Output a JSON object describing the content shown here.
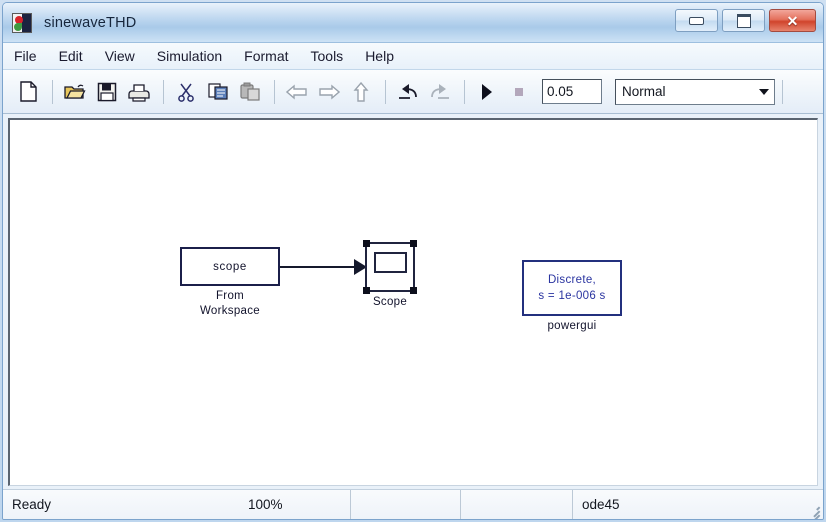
{
  "window": {
    "title": "sinewaveTHD",
    "app_icon": "simulink-icon",
    "controls": {
      "minimize": "minimize-icon",
      "maximize": "maximize-icon",
      "close": "✕"
    }
  },
  "menubar": {
    "items": [
      {
        "label": "File"
      },
      {
        "label": "Edit"
      },
      {
        "label": "View"
      },
      {
        "label": "Simulation"
      },
      {
        "label": "Format"
      },
      {
        "label": "Tools"
      },
      {
        "label": "Help"
      }
    ]
  },
  "toolbar": {
    "buttons": [
      {
        "name": "new-model-button",
        "icon": "new-document-icon"
      },
      {
        "name": "open-model-button",
        "icon": "open-folder-icon"
      },
      {
        "name": "save-model-button",
        "icon": "save-disk-icon"
      },
      {
        "name": "print-button",
        "icon": "printer-icon"
      },
      {
        "name": "cut-button",
        "icon": "scissors-icon"
      },
      {
        "name": "copy-button",
        "icon": "copy-icon"
      },
      {
        "name": "paste-button",
        "icon": "paste-icon"
      },
      {
        "name": "back-button",
        "icon": "arrow-left-icon"
      },
      {
        "name": "forward-button",
        "icon": "arrow-right-icon"
      },
      {
        "name": "up-level-button",
        "icon": "arrow-up-icon"
      },
      {
        "name": "undo-button",
        "icon": "undo-icon"
      },
      {
        "name": "redo-button",
        "icon": "redo-icon"
      },
      {
        "name": "start-simulation-button",
        "icon": "play-icon"
      },
      {
        "name": "stop-simulation-button",
        "icon": "stop-icon"
      }
    ],
    "sim_time": "0.05",
    "sim_mode": "Normal"
  },
  "canvas": {
    "blocks": [
      {
        "name": "from-workspace-block",
        "inner_text": "scope",
        "label": "From\nWorkspace"
      },
      {
        "name": "scope-block",
        "label": "Scope",
        "selected": true
      },
      {
        "name": "powergui-block",
        "line1": "Discrete,",
        "line2": "s = 1e-006 s",
        "label": "powergui"
      }
    ]
  },
  "statusbar": {
    "status": "Ready",
    "zoom": "100%",
    "pane3": "",
    "pane4": "",
    "solver": "ode45"
  }
}
